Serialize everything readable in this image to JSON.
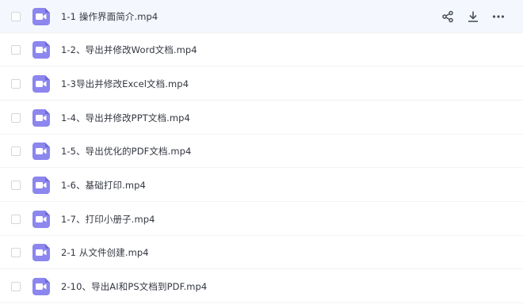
{
  "files": [
    {
      "name": "1-1 操作界面简介.mp4",
      "icon": "video-file-icon"
    },
    {
      "name": "1-2、导出并修改Word文档.mp4",
      "icon": "video-file-icon"
    },
    {
      "name": "1-3导出并修改Excel文档.mp4",
      "icon": "video-file-icon"
    },
    {
      "name": "1-4、导出并修改PPT文档.mp4",
      "icon": "video-file-icon"
    },
    {
      "name": "1-5、导出优化的PDF文档.mp4",
      "icon": "video-file-icon"
    },
    {
      "name": "1-6、基础打印.mp4",
      "icon": "video-file-icon"
    },
    {
      "name": "1-7、打印小册子.mp4",
      "icon": "video-file-icon"
    },
    {
      "name": "2-1 从文件创建.mp4",
      "icon": "video-file-icon"
    },
    {
      "name": "2-10、导出AI和PS文档到PDF.mp4",
      "icon": "video-file-icon"
    }
  ],
  "row_actions": [
    "share-icon",
    "download-icon",
    "more-icon"
  ],
  "colors": {
    "icon_bg": "#8c86ee",
    "action_icon": "#4a4f5c",
    "hover_row_bg": "#f4f7fd"
  }
}
